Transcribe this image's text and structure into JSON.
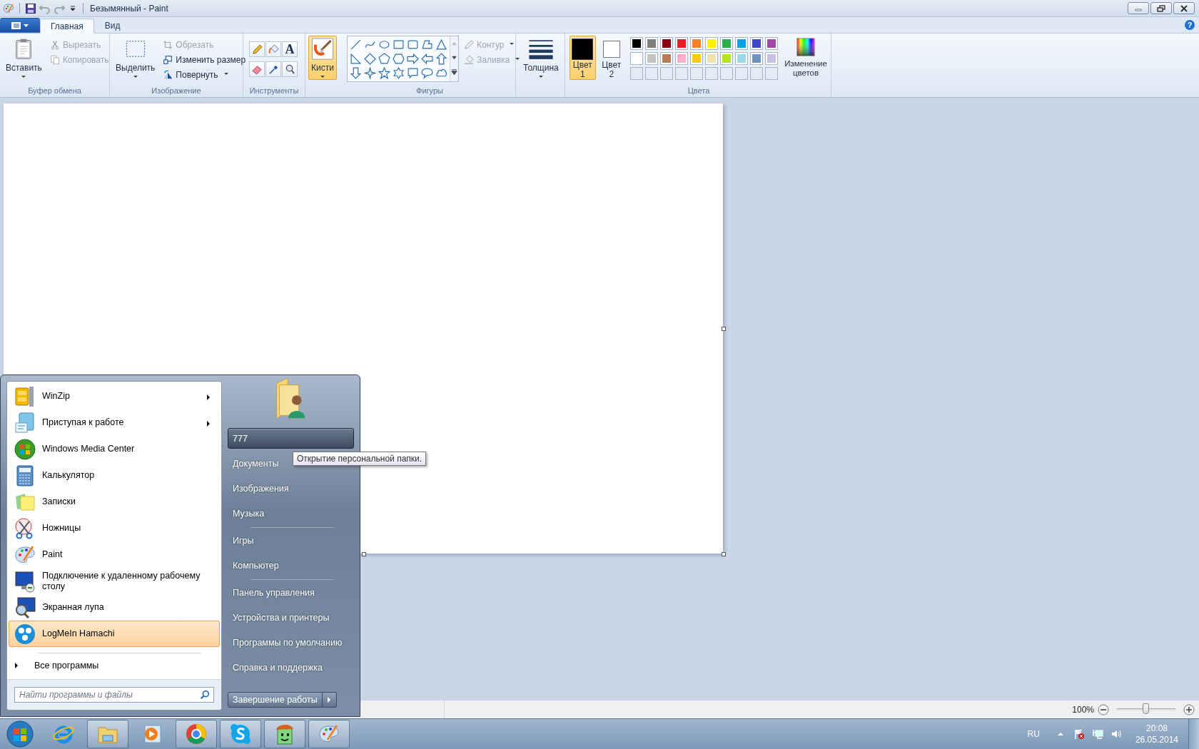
{
  "window": {
    "title": "Безымянный - Paint"
  },
  "tabs": [
    {
      "label": "Главная",
      "selected": true
    },
    {
      "label": "Вид",
      "selected": false
    }
  ],
  "help_glyph": "?",
  "ribbon": {
    "clipboard": {
      "label": "Буфер обмена",
      "paste": "Вставить",
      "actions": [
        {
          "label": "Вырезать",
          "disabled": true
        },
        {
          "label": "Копировать",
          "disabled": true
        }
      ]
    },
    "image": {
      "label": "Изображение",
      "select": "Выделить",
      "actions": [
        {
          "label": "Обрезать",
          "disabled": true,
          "dropdown": false
        },
        {
          "label": "Изменить размер",
          "disabled": false,
          "dropdown": false
        },
        {
          "label": "Повернуть",
          "disabled": false,
          "dropdown": true
        }
      ]
    },
    "tools": {
      "label": "Инструменты",
      "text_glyph": "A"
    },
    "brushes": {
      "label": "Кисти",
      "selected": true
    },
    "shapes": {
      "label": "Фигуры",
      "outline": {
        "label": "Контур",
        "disabled": true
      },
      "fill": {
        "label": "Заливка",
        "disabled": true
      }
    },
    "size": {
      "label": "Толщина"
    },
    "colors": {
      "label": "Цвета",
      "color1": {
        "label": "Цвет 1",
        "color": "#000000",
        "selected": true
      },
      "color2": {
        "label": "Цвет 2",
        "color": "#ffffff",
        "selected": false
      },
      "palette": [
        {
          "color": "#000000"
        },
        {
          "color": "#7f7f7f"
        },
        {
          "color": "#880015"
        },
        {
          "color": "#ed1c24"
        },
        {
          "color": "#ff7f27"
        },
        {
          "color": "#fff200"
        },
        {
          "color": "#22b14c"
        },
        {
          "color": "#00a2e8"
        },
        {
          "color": "#3f48cc"
        },
        {
          "color": "#a349a4"
        },
        {
          "color": "#ffffff"
        },
        {
          "color": "#c3c3c3"
        },
        {
          "color": "#b97a57"
        },
        {
          "color": "#ffaec9"
        },
        {
          "color": "#ffc90e"
        },
        {
          "color": "#efe4b0"
        },
        {
          "color": "#b5e61d"
        },
        {
          "color": "#99d9ea"
        },
        {
          "color": "#7092be"
        },
        {
          "color": "#c8bfe7"
        }
      ],
      "edit": "Изменение цветов"
    }
  },
  "status_bar": {
    "zoom": "100%",
    "zoom_slider": {
      "level": 0.5
    }
  },
  "start_menu": {
    "programs": [
      {
        "label": "WinZip",
        "submenu": true,
        "selected": false
      },
      {
        "label": "Приступая к работе",
        "submenu": true,
        "selected": false
      },
      {
        "label": "Windows Media Center",
        "submenu": false,
        "selected": false
      },
      {
        "label": "Калькулятор",
        "submenu": false,
        "selected": false
      },
      {
        "label": "Записки",
        "submenu": false,
        "selected": false
      },
      {
        "label": "Ножницы",
        "submenu": false,
        "selected": false
      },
      {
        "label": "Paint",
        "submenu": false,
        "selected": false
      },
      {
        "label": "Подключение к удаленному рабочему столу",
        "submenu": false,
        "selected": false
      },
      {
        "label": "Экранная лупа",
        "submenu": false,
        "selected": false
      },
      {
        "label": "LogMeIn Hamachi",
        "submenu": false,
        "selected": true
      }
    ],
    "all_programs": "Все программы",
    "search": {
      "placeholder": "Найти программы и файлы"
    },
    "user": {
      "label": "777",
      "selected": true
    },
    "tooltip": "Открытие персональной папки.",
    "place_groups": [
      [
        "Документы",
        "Изображения",
        "Музыка"
      ],
      [
        "Игры",
        "Компьютер"
      ],
      [
        "Панель управления",
        "Устройства и принтеры",
        "Программы по умолчанию",
        "Справка и поддержка"
      ]
    ],
    "shutdown": "Завершение работы"
  },
  "taskbar": {
    "apps": [
      {
        "running": false
      },
      {
        "running": true
      },
      {
        "running": false
      },
      {
        "running": true
      },
      {
        "running": true
      },
      {
        "running": true
      },
      {
        "running": true
      }
    ],
    "language": "RU",
    "time": "20:08",
    "date": "26.05.2014"
  }
}
